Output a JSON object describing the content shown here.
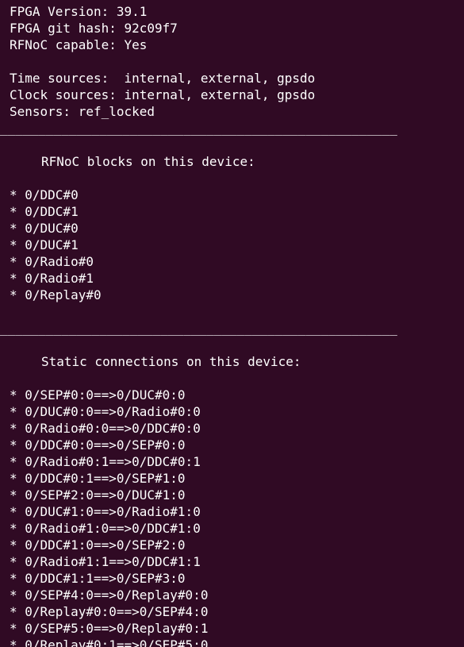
{
  "header_lines": [
    "FPGA Version: 39.1",
    "FPGA git hash: 92c09f7",
    "RFNoC capable: Yes"
  ],
  "source_lines": [
    "Time sources:  internal, external, gpsdo",
    "Clock sources: internal, external, gpsdo",
    "Sensors: ref_locked"
  ],
  "separator": "____________________________________________________",
  "blocks": {
    "heading": "RFNoC blocks on this device:",
    "items": [
      "0/DDC#0",
      "0/DDC#1",
      "0/DUC#0",
      "0/DUC#1",
      "0/Radio#0",
      "0/Radio#1",
      "0/Replay#0"
    ]
  },
  "connections": {
    "heading": "Static connections on this device:",
    "items": [
      "0/SEP#0:0==>0/DUC#0:0",
      "0/DUC#0:0==>0/Radio#0:0",
      "0/Radio#0:0==>0/DDC#0:0",
      "0/DDC#0:0==>0/SEP#0:0",
      "0/Radio#0:1==>0/DDC#0:1",
      "0/DDC#0:1==>0/SEP#1:0",
      "0/SEP#2:0==>0/DUC#1:0",
      "0/DUC#1:0==>0/Radio#1:0",
      "0/Radio#1:0==>0/DDC#1:0",
      "0/DDC#1:0==>0/SEP#2:0",
      "0/Radio#1:1==>0/DDC#1:1",
      "0/DDC#1:1==>0/SEP#3:0",
      "0/SEP#4:0==>0/Replay#0:0",
      "0/Replay#0:0==>0/SEP#4:0",
      "0/SEP#5:0==>0/Replay#0:1",
      "0/Replay#0:1==>0/SEP#5:0"
    ]
  },
  "colors": {
    "background": "#300a24",
    "text": "#ffffff"
  }
}
